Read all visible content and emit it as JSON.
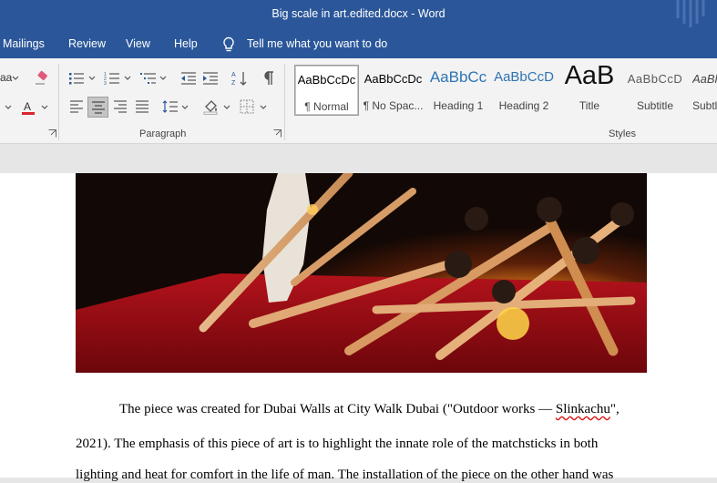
{
  "window": {
    "title": "Big scale in art.edited.docx  -  Word"
  },
  "tabs": {
    "mailings": "Mailings",
    "review": "Review",
    "view": "View",
    "help": "Help",
    "tell_me": "Tell me what you want to do"
  },
  "ribbon": {
    "font_partial": "aa",
    "paragraph_label": "Paragraph",
    "styles_label": "Styles",
    "styles": [
      {
        "preview": "AaBbCcDc",
        "name": "¶ Normal"
      },
      {
        "preview": "AaBbCcDc",
        "name": "¶ No Spac..."
      },
      {
        "preview": "AaBbCc",
        "name": "Heading 1"
      },
      {
        "preview": "AaBbCcD",
        "name": "Heading 2"
      },
      {
        "preview": "AaB",
        "name": "Title"
      },
      {
        "preview": "AaBbCcD",
        "name": "Subtitle"
      },
      {
        "preview": "AaBl",
        "name": "Subtl"
      }
    ]
  },
  "document": {
    "para1_line1_prefix": "The piece was created for Dubai Walls at City Walk Dubai (\"Outdoor works — ",
    "para1_line1_spell": "Slinkachu",
    "para1_line1_suffix": "\",",
    "para1_line2": "2021). The emphasis of this piece of art is to highlight the innate role of the matchsticks in both",
    "para1_line3": "lighting and heat for comfort in the life of man. The installation of the piece on the other hand was"
  },
  "colors": {
    "title_bar": "#2b579a",
    "ribbon_bg": "#f3f3f3",
    "heading_blue": "#2e74b5",
    "font_color_red": "#d9262c"
  }
}
